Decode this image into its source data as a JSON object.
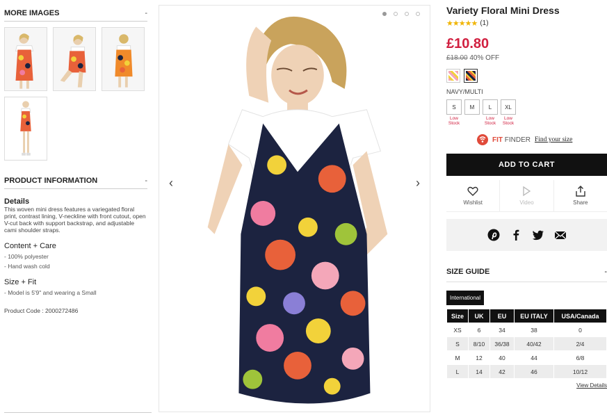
{
  "left": {
    "more_images": {
      "label": "MORE IMAGES",
      "toggle": "-"
    },
    "product_info": {
      "label": "PRODUCT INFORMATION",
      "toggle": "-"
    },
    "details_title": "Details",
    "details_text": "This woven mini dress features a variegated floral print, contrast lining, V-neckline with front cutout, open V-cut back with support backstrap, and adjustable cami shoulder straps.",
    "content_title": "Content + Care",
    "content_lines": [
      "- 100% polyester",
      "- Hand wash cold"
    ],
    "size_title": "Size + Fit",
    "size_lines": [
      "- Model is 5'9\" and wearing a Small"
    ],
    "product_code": "Product Code : 2000272486"
  },
  "gallery": {
    "prev": "‹",
    "next": "›"
  },
  "product": {
    "title": "Variety Floral Mini Dress",
    "stars": "★★★★★",
    "review_count": "(1)",
    "price": "£10.80",
    "original_price": "£18.00",
    "discount": "40% OFF",
    "color_label": "NAVY/MULTI",
    "sizes": [
      {
        "label": "S",
        "stock": ""
      },
      {
        "label": "M",
        "stock": ""
      },
      {
        "label": "L",
        "stock": "Low Stock"
      },
      {
        "label": "XL",
        "stock": "Low Stock"
      }
    ],
    "size_s_stock": "Low Stock",
    "fit_finder_a": "FIT",
    "fit_finder_b": " FINDER",
    "find_size": "Find your size",
    "add_to_cart": "ADD TO CART",
    "wishlist": "Wishlist",
    "video": "Video",
    "share": "Share"
  },
  "size_guide": {
    "title": "SIZE GUIDE",
    "toggle": "-",
    "tab": "International",
    "headers": [
      "Size",
      "UK",
      "EU",
      "EU ITALY",
      "USA/Canada"
    ],
    "rows": [
      [
        "XS",
        "6",
        "34",
        "38",
        "0"
      ],
      [
        "S",
        "8/10",
        "36/38",
        "40/42",
        "2/4"
      ],
      [
        "M",
        "12",
        "40",
        "44",
        "6/8"
      ],
      [
        "L",
        "14",
        "42",
        "46",
        "10/12"
      ]
    ],
    "view_details": "View Details"
  },
  "colors": {
    "price": "#d12040",
    "button": "#111111",
    "stars": "#f0b400",
    "fit_finder": "#e04a3a"
  }
}
